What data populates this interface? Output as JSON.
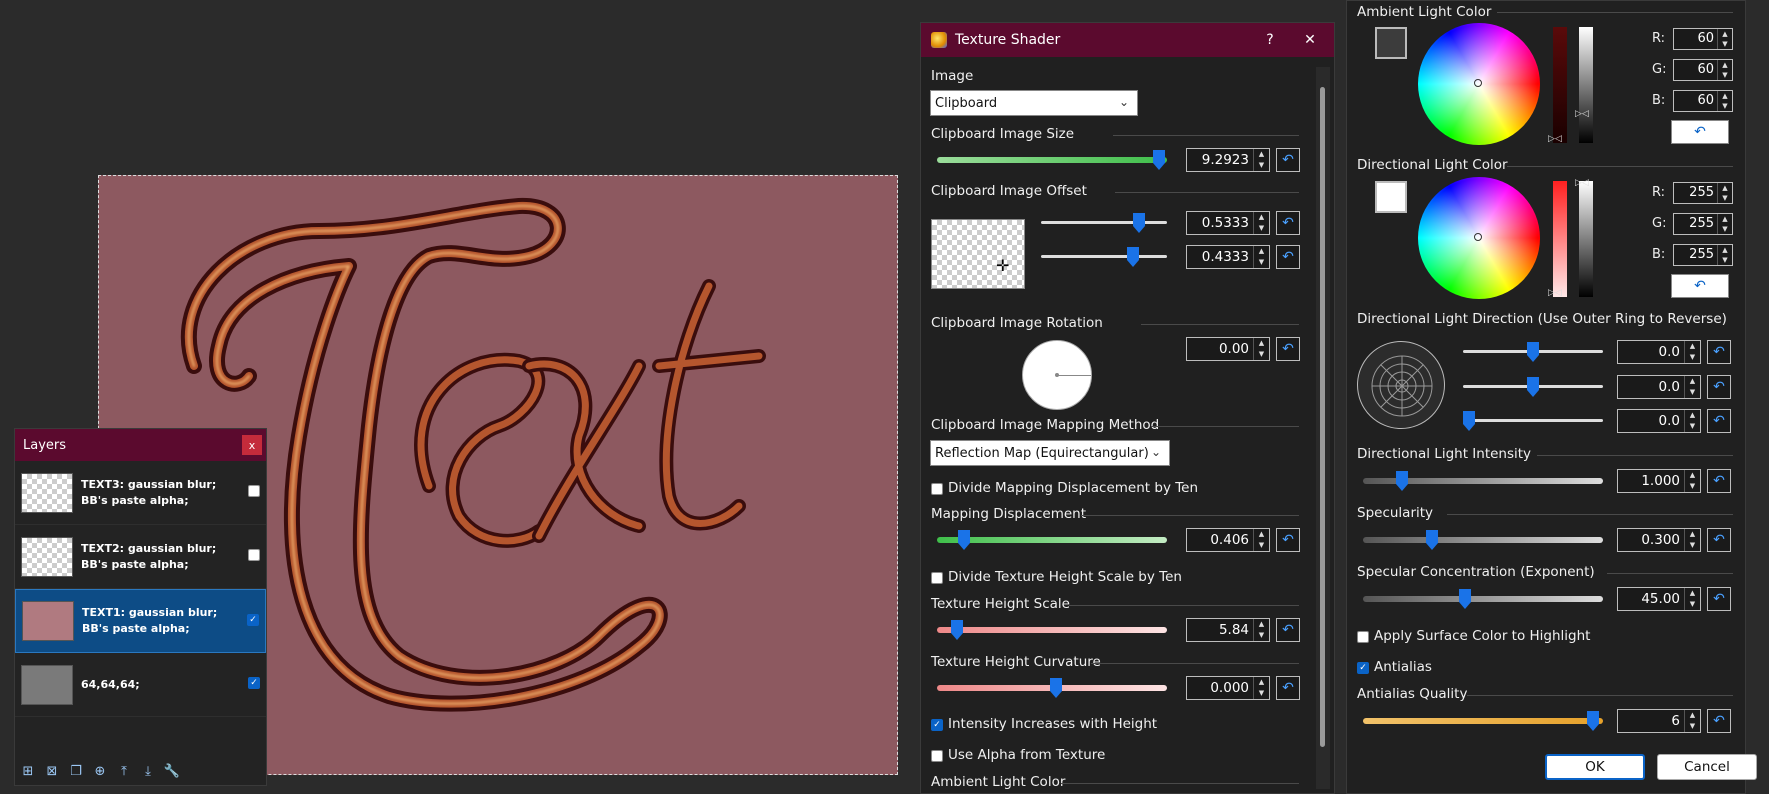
{
  "layers": {
    "title": "Layers",
    "close": "x",
    "items": [
      {
        "name": "TEXT3: gaussian blur; BB's paste alpha;",
        "visible": false,
        "selected": false
      },
      {
        "name": "TEXT2: gaussian blur; BB's paste alpha;",
        "visible": false,
        "selected": false
      },
      {
        "name": "TEXT1: gaussian blur; BB's paste alpha;",
        "visible": true,
        "selected": true
      },
      {
        "name": "64,64,64;",
        "visible": true,
        "selected": false
      }
    ]
  },
  "canvas": {
    "text": "Text",
    "background": "#8d5960"
  },
  "shader": {
    "title": "Texture Shader",
    "help": "?",
    "close": "✕",
    "image_label": "Image",
    "image_value": "Clipboard",
    "size_label": "Clipboard Image Size",
    "size_value": "9.2923",
    "size_level": 0.95,
    "offset_label": "Clipboard Image Offset",
    "offset_x": "0.5333",
    "offset_y": "0.4333",
    "rotation_label": "Clipboard Image Rotation",
    "rotation_value": "0.00",
    "mapping_label": "Clipboard Image Mapping Method",
    "mapping_value": "Reflection Map (Equirectangular)",
    "divide_disp_label": "Divide Mapping Displacement by Ten",
    "disp_label": "Mapping Displacement",
    "disp_value": "0.406",
    "divide_height_label": "Divide Texture Height Scale by Ten",
    "height_label": "Texture Height Scale",
    "height_value": "5.84",
    "curv_label": "Texture Height Curvature",
    "curv_value": "0.000",
    "intensity_label": "Intensity Increases with Height",
    "alpha_label": "Use Alpha from Texture",
    "ambient_bottom_label": "Ambient Light Color"
  },
  "lights": {
    "ambient_label": "Ambient Light Color",
    "ambient": {
      "r": "60",
      "g": "60",
      "b": "60",
      "color": "#3c3c3c"
    },
    "directional_label": "Directional Light Color",
    "directional": {
      "r": "255",
      "g": "255",
      "b": "255",
      "color": "#ffffff"
    },
    "r_label": "R:",
    "g_label": "G:",
    "b_label": "B:",
    "direction_label": "Directional Light Direction (Use Outer Ring to Reverse)",
    "dir_x": "0.0",
    "dir_y": "0.0",
    "dir_z": "0.0",
    "intensity_label": "Directional Light Intensity",
    "intensity_value": "1.000",
    "specularity_label": "Specularity",
    "specularity_value": "0.300",
    "concentration_label": "Specular Concentration (Exponent)",
    "concentration_value": "45.00",
    "surface_label": "Apply Surface Color to Highlight",
    "antialias_label": "Antialias",
    "aa_quality_label": "Antialias Quality",
    "aa_quality_value": "6",
    "ok": "OK",
    "cancel": "Cancel"
  }
}
